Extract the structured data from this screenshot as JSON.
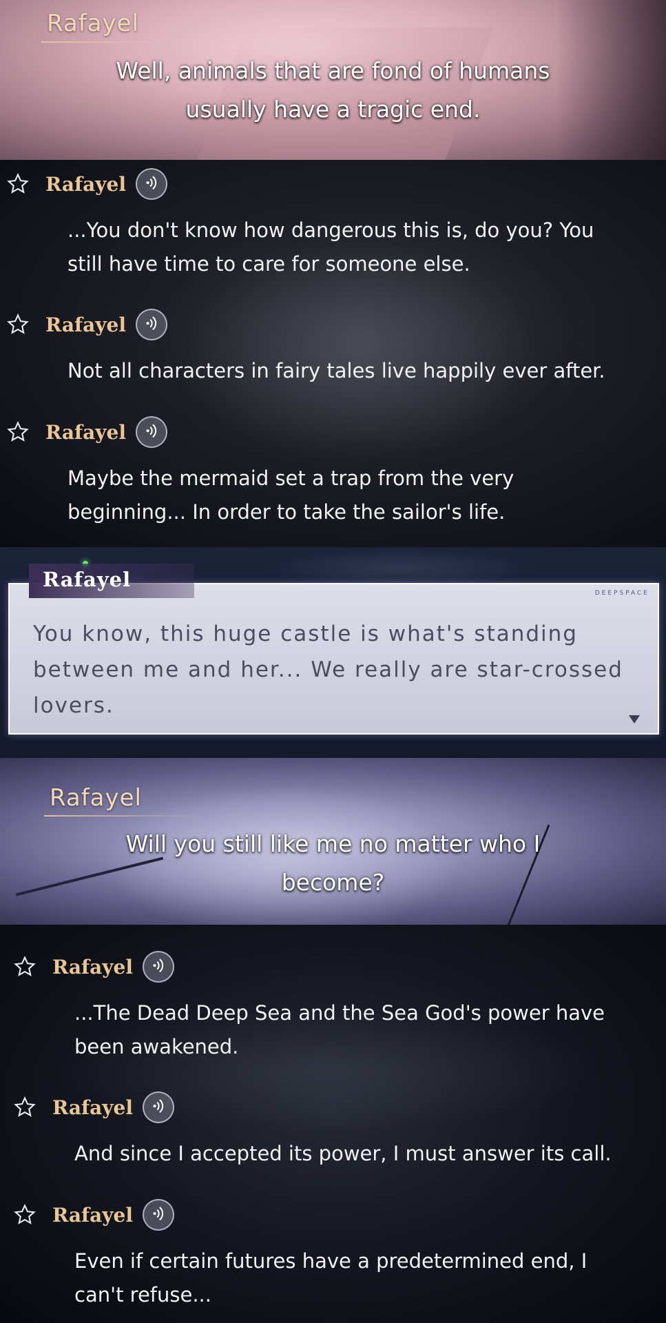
{
  "scenes": [
    {
      "speaker": "Rafayel",
      "lines": [
        "Well, animals that are fond of humans",
        "usually have a tragic end."
      ]
    },
    {
      "speaker": "Rafayel",
      "lines": [
        "Will you still like me no matter who I",
        "become?"
      ]
    }
  ],
  "log_top": [
    {
      "name": "Rafayel",
      "lines": [
        "...You don't know how dangerous this is, do you? You",
        "still have time to care for someone else."
      ]
    },
    {
      "name": "Rafayel",
      "lines": [
        "Not all characters in fairy tales live happily ever after."
      ]
    },
    {
      "name": "Rafayel",
      "lines": [
        "Maybe the mermaid set a trap from the very",
        "beginning... In order to take the sailor's life."
      ]
    }
  ],
  "dialog": {
    "speaker": "Rafayel",
    "brand": "DEEPSPACE",
    "lines": [
      "You know, this huge castle is what's standing",
      "between me and her... We really are star-crossed",
      "lovers."
    ]
  },
  "log_bottom": [
    {
      "name": "Rafayel",
      "lines": [
        "...The Dead Deep Sea and the Sea God's power have",
        "been awakened."
      ]
    },
    {
      "name": "Rafayel",
      "lines": [
        "And since I accepted its power, I must answer its call."
      ]
    },
    {
      "name": "Rafayel",
      "lines": [
        "Even if certain futures have a predetermined end, I",
        "can't refuse..."
      ]
    }
  ]
}
